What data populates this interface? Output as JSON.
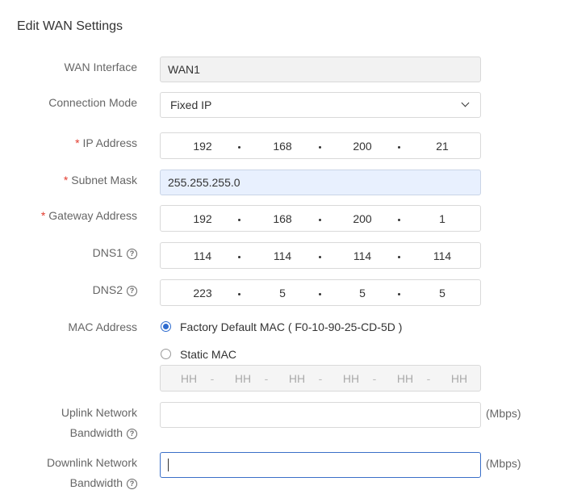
{
  "title": "Edit WAN Settings",
  "wan_interface": {
    "label": "WAN Interface",
    "value": "WAN1"
  },
  "connection_mode": {
    "label": "Connection Mode",
    "value": "Fixed IP",
    "icon": "chevron-down-icon"
  },
  "ip_address": {
    "label": "IP Address",
    "required": "*",
    "octets": [
      "192",
      "168",
      "200",
      "21"
    ]
  },
  "subnet_mask": {
    "label": "Subnet Mask",
    "required": "*",
    "value": "255.255.255.0"
  },
  "gateway": {
    "label": "Gateway Address",
    "required": "*",
    "octets": [
      "192",
      "168",
      "200",
      "1"
    ]
  },
  "dns1": {
    "label": "DNS1",
    "help": "?",
    "octets": [
      "114",
      "114",
      "114",
      "114"
    ]
  },
  "dns2": {
    "label": "DNS2",
    "help": "?",
    "octets": [
      "223",
      "5",
      "5",
      "5"
    ]
  },
  "mac": {
    "label": "MAC Address",
    "option_default": "Factory Default MAC ( F0-10-90-25-CD-5D )",
    "option_static": "Static MAC",
    "selected": "default",
    "placeholder_segments": [
      "HH",
      "HH",
      "HH",
      "HH",
      "HH",
      "HH"
    ],
    "separator": "-"
  },
  "uplink": {
    "label_line1": "Uplink Network",
    "label_line2": "Bandwidth",
    "help": "?",
    "value": "",
    "unit": "(Mbps)"
  },
  "downlink": {
    "label_line1": "Downlink Network",
    "label_line2": "Bandwidth",
    "help": "?",
    "value": "",
    "unit": "(Mbps)"
  },
  "colors": {
    "required": "#e23b2e",
    "accent": "#2e6ccf",
    "highlight_bg": "#e8f0fe"
  }
}
